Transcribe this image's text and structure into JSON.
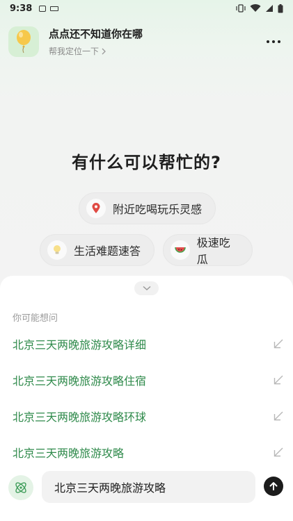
{
  "status_bar": {
    "time": "9:38",
    "icons": [
      "notification-a-icon",
      "keyboard-icon",
      "vibrate-icon",
      "wifi-icon",
      "signal-icon",
      "battery-icon"
    ]
  },
  "header": {
    "title": "点点还不知道你在哪",
    "subtitle": "帮我定位一下",
    "avatar_icon": "balloon-icon"
  },
  "main": {
    "title": "有什么可以帮忙的?",
    "chips": [
      {
        "label": "附近吃喝玩乐灵感",
        "icon": "location-pin-icon"
      },
      {
        "label": "生活难题速答",
        "icon": "lightbulb-icon"
      },
      {
        "label": "极速吃瓜",
        "icon": "watermelon-icon"
      }
    ]
  },
  "suggestions": {
    "heading": "你可能想问",
    "items": [
      {
        "match": "北京三天两晚旅游攻略",
        "rest": "详细"
      },
      {
        "match": "北京三天两晚旅游攻略",
        "rest": "住宿"
      },
      {
        "match": "北京三天两晚旅游攻略",
        "rest": "环球"
      },
      {
        "match": "北京三天两晚旅游攻略",
        "rest": ""
      }
    ]
  },
  "input": {
    "value": "北京三天两晚旅游攻略"
  },
  "colors": {
    "accent_green": "#2f8a4b",
    "send_button": "#1c1c1c"
  }
}
